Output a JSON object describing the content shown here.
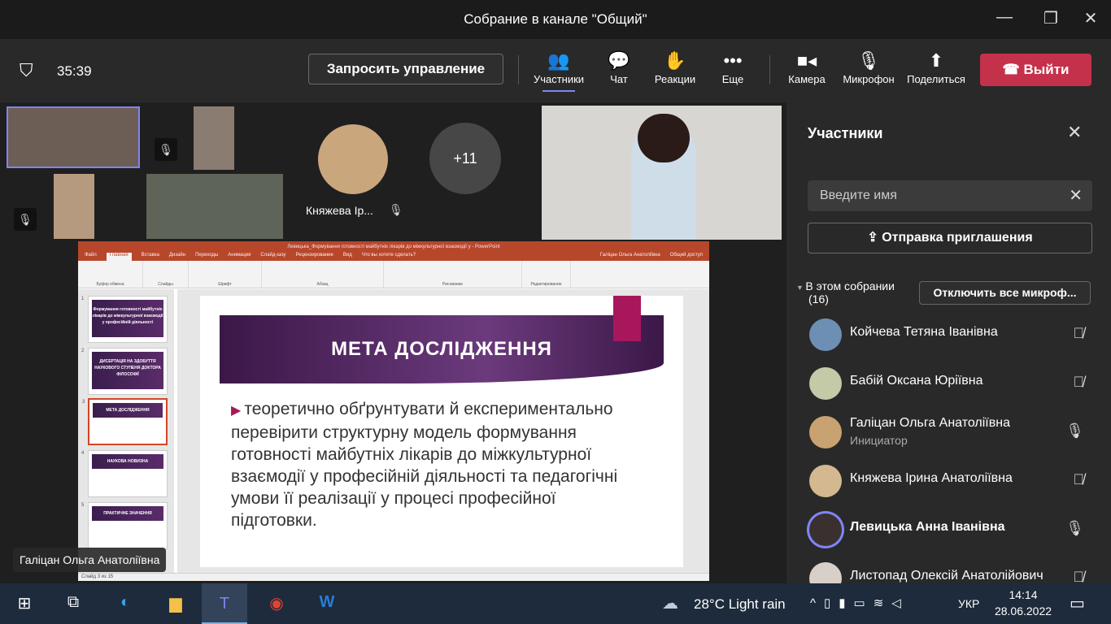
{
  "window": {
    "title": "Собрание в канале \"Общий\"",
    "minimize": "—",
    "maximize": "❐",
    "close": "✕"
  },
  "toolbar": {
    "timer": "35:39",
    "request_control": "Запросить управление",
    "participants": "Участники",
    "chat": "Чат",
    "reactions": "Реакции",
    "more": "Еще",
    "camera": "Камера",
    "mic": "Микрофон",
    "share": "Поделиться",
    "leave": "Выйти"
  },
  "videos": {
    "tile_name": "Княжева Ір...",
    "overflow": "+11"
  },
  "panel": {
    "title": "Участники",
    "search_placeholder": "Введите имя",
    "invite": "Отправка приглашения",
    "section": "В этом собрании",
    "count": "(16)",
    "mute_all": "Отключить все микроф...",
    "people": [
      {
        "name": "Койчева Тетяна Іванівна",
        "role": "",
        "muted": true
      },
      {
        "name": "Бабій Оксана Юріївна",
        "role": "",
        "muted": true
      },
      {
        "name": "Галіцан Ольга Анатоліївна",
        "role": "Инициатор",
        "muted": false
      },
      {
        "name": "Княжева Ірина Анатоліївна",
        "role": "",
        "muted": true
      },
      {
        "name": "Левицька Анна Іванівна",
        "role": "",
        "muted": false
      },
      {
        "name": "Листопад Олексій Анатолійович",
        "role": "",
        "muted": true
      }
    ]
  },
  "ppt": {
    "title": "Левицька_Формування готовності майбутніх лікарів до міжкультурної взаємодії у - PowerPoint",
    "tabs": [
      "Файл",
      "Главная",
      "Вставка",
      "Дизайн",
      "Переходы",
      "Анимация",
      "Слайд-шоу",
      "Рецензирование",
      "Вид",
      "Что вы хотите сделать?"
    ],
    "groups": [
      "Буфер обмена",
      "Слайды",
      "Шрифт",
      "Абзац",
      "Рисование",
      "Редактирование"
    ],
    "user": "Галіцан Ольга Анатоліївна",
    "share": "Общий доступ",
    "thumbs": [
      {
        "n": "1",
        "title": "Формування готовності майбутніх лікарів до міжкультурної взаємодії у професійній діяльності"
      },
      {
        "n": "2",
        "title": "ДИСЕРТАЦІЯ НА ЗДОБУТТЯ НАУКОВОГО СТУПЕНЯ ДОКТОРА ФІЛОСОФІЇ"
      },
      {
        "n": "3",
        "title": "МЕТА ДОСЛІДЖЕННЯ"
      },
      {
        "n": "4",
        "title": "НАУКОВА НОВИЗНА"
      },
      {
        "n": "5",
        "title": "ПРАКТИЧНЕ ЗНАЧЕННЯ"
      }
    ],
    "slide_title": "МЕТА ДОСЛІДЖЕННЯ",
    "slide_body": "теоретично обґрунтувати й експериментально перевірити структурну модель формування готовності майбутніх лікарів до міжкультурної взаємодії у професійній діяльності та педагогічні умови її реалізації у процесі професійної підготовки.",
    "status": "Слайд 3 из 15"
  },
  "presenter": "Галіцан Ольга Анатоліївна",
  "taskbar": {
    "weather": "28°C  Light rain",
    "lang": "УКР",
    "time": "14:14",
    "date": "28.06.2022"
  }
}
